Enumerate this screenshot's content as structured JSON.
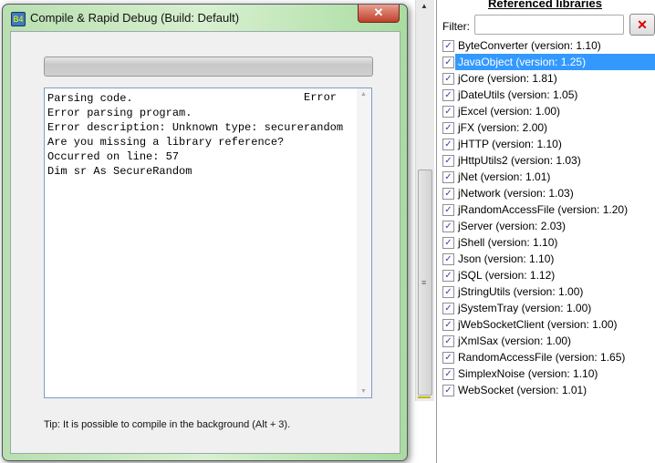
{
  "dialog": {
    "title": "Compile & Rapid Debug (Build: Default)",
    "close": "✕",
    "progress": 0,
    "log_lines": [
      "Parsing code.",
      "Error parsing program.",
      "Error description: Unknown type: securerandom",
      "Are you missing a library reference?",
      "Occurred on line: 57",
      "Dim sr As SecureRandom"
    ],
    "status": "Error",
    "tip": "Tip: It is possible to compile in the background (Alt + 3)."
  },
  "panel": {
    "title": "Referenced libraries",
    "filter_label": "Filter:",
    "filter_value": "",
    "clear": "✕",
    "libraries": [
      {
        "label": "ByteConverter (version: 1.10)",
        "checked": true
      },
      {
        "label": "JavaObject (version: 1.25)",
        "checked": true,
        "selected": true
      },
      {
        "label": "jCore (version: 1.81)",
        "checked": true
      },
      {
        "label": "jDateUtils (version: 1.05)",
        "checked": true
      },
      {
        "label": "jExcel (version: 1.00)",
        "checked": true
      },
      {
        "label": "jFX (version: 2.00)",
        "checked": true
      },
      {
        "label": "jHTTP (version: 1.10)",
        "checked": true
      },
      {
        "label": "jHttpUtils2 (version: 1.03)",
        "checked": true
      },
      {
        "label": "jNet (version: 1.01)",
        "checked": true
      },
      {
        "label": "jNetwork (version: 1.03)",
        "checked": true
      },
      {
        "label": "jRandomAccessFile (version: 1.20)",
        "checked": true
      },
      {
        "label": "jServer (version: 2.03)",
        "checked": true
      },
      {
        "label": "jShell (version: 1.10)",
        "checked": true
      },
      {
        "label": "Json (version: 1.10)",
        "checked": true
      },
      {
        "label": "jSQL (version: 1.12)",
        "checked": true
      },
      {
        "label": "jStringUtils (version: 1.00)",
        "checked": true
      },
      {
        "label": "jSystemTray (version: 1.00)",
        "checked": true
      },
      {
        "label": "jWebSocketClient (version: 1.00)",
        "checked": true
      },
      {
        "label": "jXmlSax (version: 1.00)",
        "checked": true
      },
      {
        "label": "RandomAccessFile (version: 1.65)",
        "checked": true
      },
      {
        "label": "SimplexNoise (version: 1.10)",
        "checked": true
      },
      {
        "label": "WebSocket (version: 1.01)",
        "checked": true
      }
    ]
  }
}
